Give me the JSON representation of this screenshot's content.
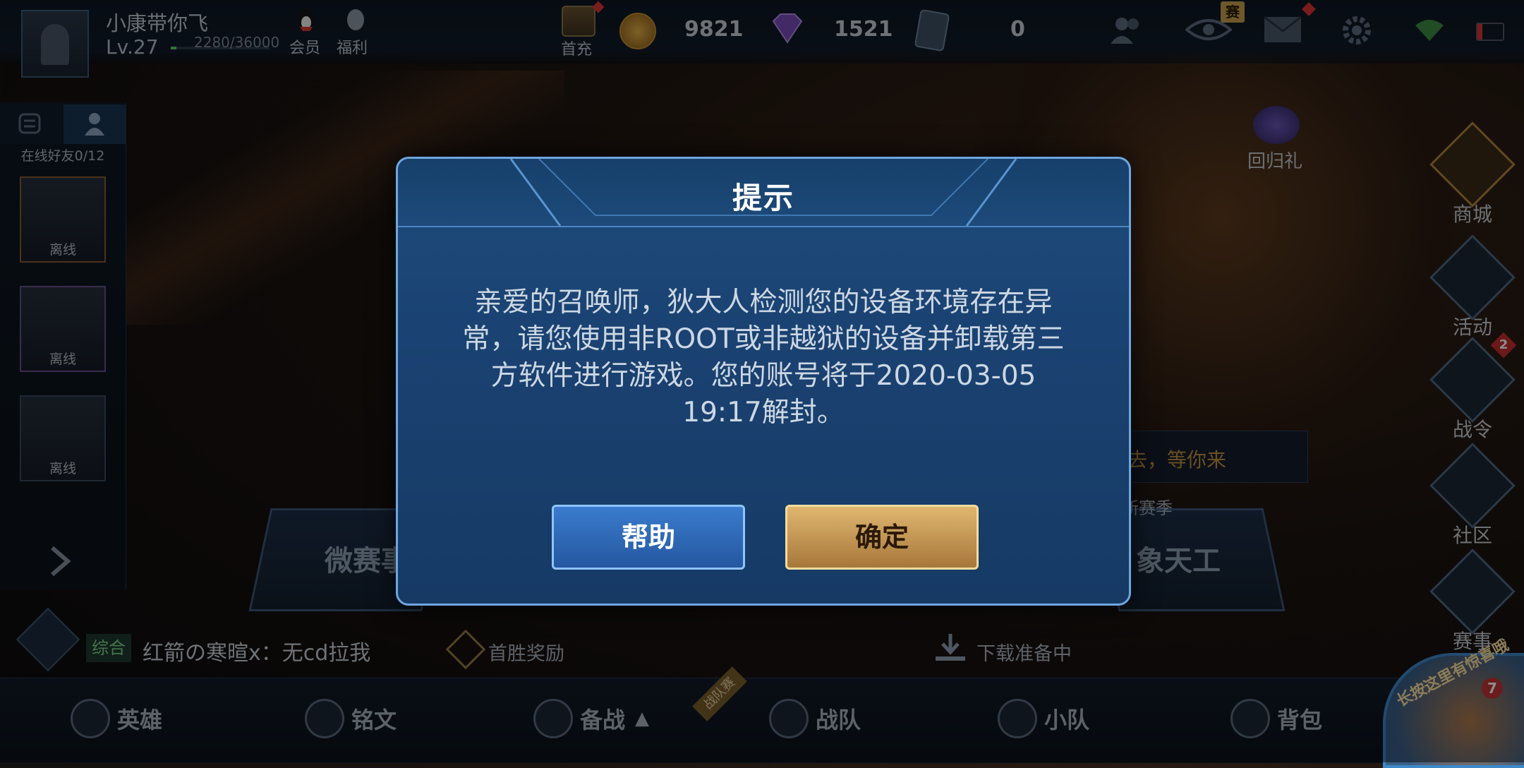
{
  "player": {
    "name": "小康带你飞",
    "level": "Lv.27",
    "exp": "2280/36000"
  },
  "top_buttons": {
    "vip": "会员",
    "welfare": "福利",
    "first_recharge": "首充"
  },
  "resources": {
    "gold": "9821",
    "diamond": "1521",
    "voucher": "0"
  },
  "top_badge": "赛",
  "friends": {
    "online_count": "在线好友0/12",
    "items": [
      {
        "status": "离线"
      },
      {
        "status": "离线"
      },
      {
        "status": "离线"
      }
    ]
  },
  "right_menu": [
    {
      "label": "商城"
    },
    {
      "label": "活动"
    },
    {
      "label": "战令",
      "badge": "2"
    },
    {
      "label": "社区"
    },
    {
      "label": "赛事"
    }
  ],
  "return_gift": "回归礼",
  "background": {
    "event_left": "微赛事",
    "event_right": "象天工",
    "new_season": "新赛季",
    "banner_text": "去，等你来"
  },
  "chat": {
    "channel": "综合",
    "message": "红箭の寒暄x：无cd拉我"
  },
  "first_win": "首胜奖励",
  "download": "下载准备中",
  "bottom_nav": [
    {
      "label": "英雄"
    },
    {
      "label": "铭文"
    },
    {
      "label": "备战"
    },
    {
      "label": "战队"
    },
    {
      "label": "小队"
    },
    {
      "label": "背包"
    }
  ],
  "team_tag": "战队赛",
  "corner_avatar": {
    "text": "长按这里有惊喜哦",
    "badge": "7"
  },
  "dialog": {
    "title": "提示",
    "message": "亲爱的召唤师，狄大人检测您的设备环境存在异常，请您使用非ROOT或非越狱的设备并卸载第三方软件进行游戏。您的账号将于2020-03-05 19:17解封。",
    "help_label": "帮助",
    "ok_label": "确定"
  },
  "colors": {
    "dialog_bg": "#1a4272",
    "help_button": "#2f6bb8",
    "ok_button": "#c9994f"
  }
}
